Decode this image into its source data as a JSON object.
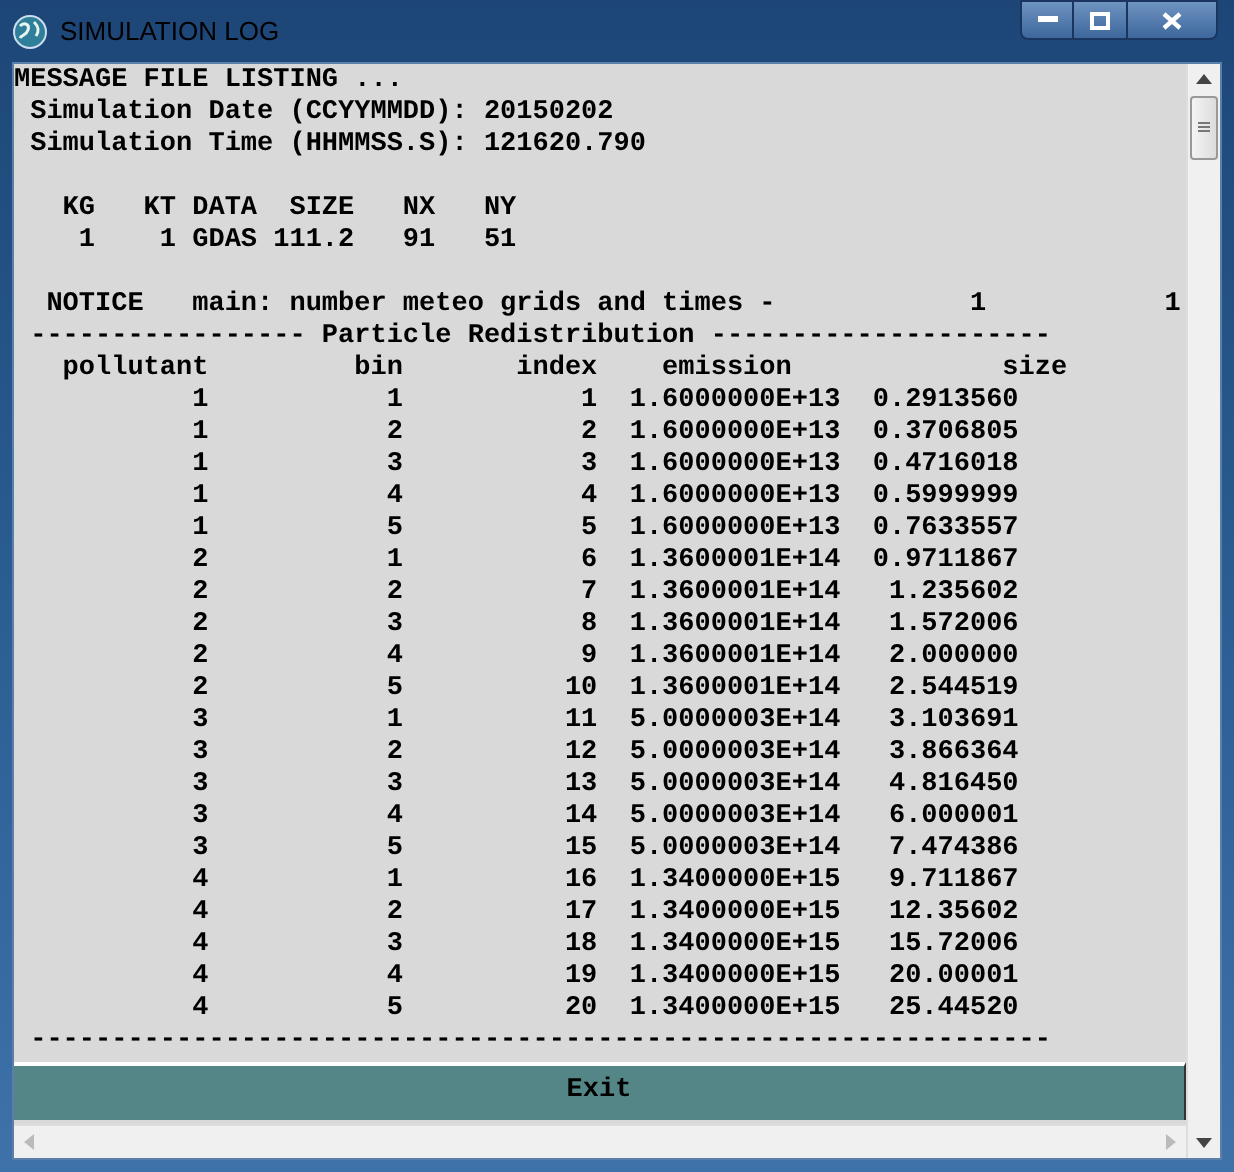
{
  "window": {
    "title": "SIMULATION LOG"
  },
  "log": {
    "blocks": [
      [
        "MESSAGE FILE LISTING ...",
        " Simulation Date (CCYYMMDD): 20150202",
        " Simulation Time (HHMMSS.S): 121620.790"
      ],
      [
        "   KG   KT DATA  SIZE   NX   NY",
        "    1    1 GDAS 111.2   91   51"
      ],
      [
        "  NOTICE   main: number meteo grids and times -            1           1",
        " ----------------- Particle Redistribution ---------------------",
        "   pollutant         bin       index    emission             size",
        "           1           1           1  1.6000000E+13  0.2913560",
        "           1           2           2  1.6000000E+13  0.3706805",
        "           1           3           3  1.6000000E+13  0.4716018",
        "           1           4           4  1.6000000E+13  0.5999999",
        "           1           5           5  1.6000000E+13  0.7633557",
        "           2           1           6  1.3600001E+14  0.9711867",
        "           2           2           7  1.3600001E+14   1.235602",
        "           2           3           8  1.3600001E+14   1.572006",
        "           2           4           9  1.3600001E+14   2.000000",
        "           2           5          10  1.3600001E+14   2.544519",
        "           3           1          11  5.0000003E+14   3.103691",
        "           3           2          12  5.0000003E+14   3.866364",
        "           3           3          13  5.0000003E+14   4.816450",
        "           3           4          14  5.0000003E+14   6.000001",
        "           3           5          15  5.0000003E+14   7.474386",
        "           4           1          16  1.3400000E+15   9.711867",
        "           4           2          17  1.3400000E+15   12.35602",
        "           4           3          18  1.3400000E+15   15.72006",
        "           4           4          19  1.3400000E+15   20.00001",
        "           4           5          20  1.3400000E+15   25.44520",
        " ---------------------------------------------------------------"
      ]
    ]
  },
  "button": {
    "label": "Exit"
  }
}
